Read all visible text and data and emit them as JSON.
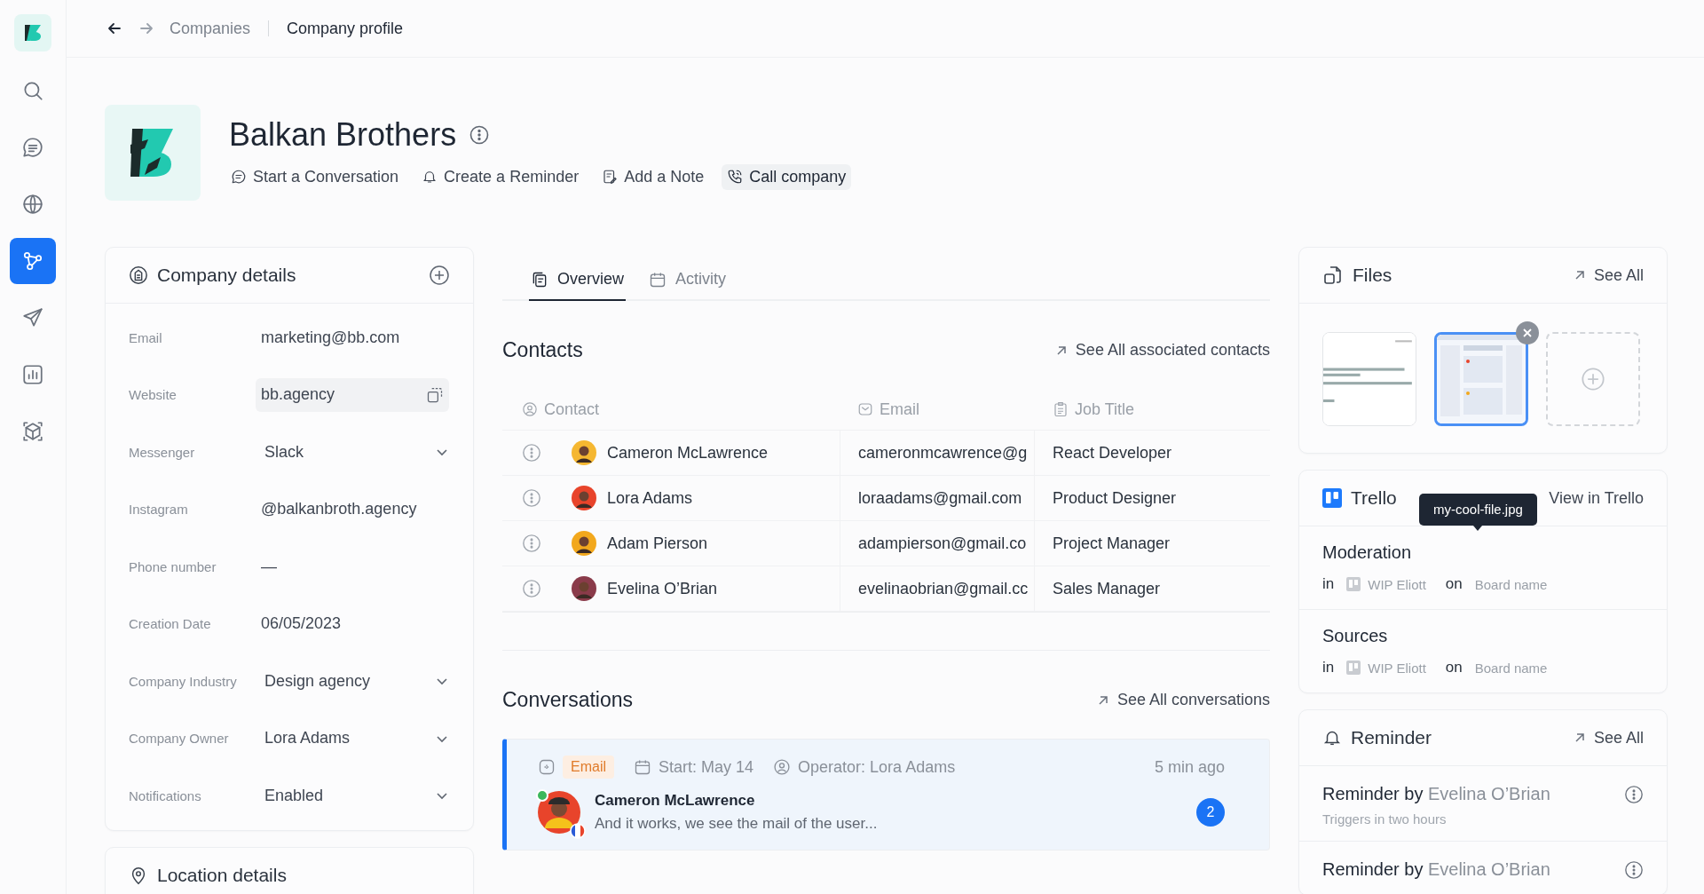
{
  "sidebar": {
    "items": [
      {
        "kind": "search",
        "selected": false
      },
      {
        "kind": "chat",
        "selected": false
      },
      {
        "kind": "globe",
        "selected": false
      },
      {
        "kind": "network",
        "selected": true
      },
      {
        "kind": "send",
        "selected": false
      },
      {
        "kind": "chart",
        "selected": false
      },
      {
        "kind": "cube",
        "selected": false
      }
    ]
  },
  "breadcrumb": [
    "Companies",
    "Company profile"
  ],
  "company": {
    "name": "Balkan Brothers",
    "actions": [
      {
        "kind": "chat",
        "label": "Start a Conversation",
        "highlighted": false
      },
      {
        "kind": "bell",
        "label": "Create a Reminder",
        "highlighted": false
      },
      {
        "kind": "note",
        "label": "Add a Note",
        "highlighted": false
      },
      {
        "kind": "phone",
        "label": "Call company",
        "highlighted": true
      }
    ]
  },
  "details": {
    "title": "Company details",
    "fields": [
      {
        "label": "Email",
        "value": "marketing@bb.com",
        "kind": "text"
      },
      {
        "label": "Website",
        "value": "bb.agency",
        "kind": "copy"
      },
      {
        "label": "Messenger",
        "value": "Slack",
        "kind": "dropdown"
      },
      {
        "label": "Instagram",
        "value": "@balkanbroth.agency",
        "kind": "text"
      },
      {
        "label": "Phone number",
        "value": "—",
        "kind": "text"
      },
      {
        "label": "Creation Date",
        "value": "06/05/2023",
        "kind": "text"
      },
      {
        "label": "Company Industry",
        "value": "Design agency",
        "kind": "dropdown"
      },
      {
        "label": "Company Owner",
        "value": "Lora Adams",
        "kind": "dropdown"
      },
      {
        "label": "Notifications",
        "value": "Enabled",
        "kind": "dropdown"
      }
    ]
  },
  "location": {
    "title": "Location details"
  },
  "tabs": [
    {
      "label": "Overview",
      "kind": "overview",
      "selected": true
    },
    {
      "label": "Activity",
      "kind": "calendar",
      "selected": false
    }
  ],
  "contacts": {
    "title": "Contacts",
    "link": "See All associated contacts",
    "columns": [
      {
        "label": "Contact",
        "kind": "person"
      },
      {
        "label": "Email",
        "kind": "mail"
      },
      {
        "label": "Job Title",
        "kind": "badge"
      }
    ],
    "rows": [
      {
        "name": "Cameron McLawrence",
        "email": "cameronmcawrence@g",
        "job": "React Developer"
      },
      {
        "name": "Lora Adams",
        "email": "loraadams@gmail.com",
        "job": "Product Designer"
      },
      {
        "name": "Adam Pierson",
        "email": "adampierson@gmail.co",
        "job": "Project Manager"
      },
      {
        "name": "Evelina O’Brian",
        "email": "evelinaobrian@gmail.cc",
        "job": "Sales Manager"
      }
    ]
  },
  "conversations": {
    "title": "Conversations",
    "link": "See All conversations",
    "items": [
      {
        "channel": "Email",
        "start": "Start: May 14",
        "operator": "Operator: Lora Adams",
        "time": "5 min ago",
        "name": "Cameron McLawrence",
        "preview": "And it works, we see the mail of the user...",
        "unread": "2",
        "online": true,
        "selected": true
      }
    ]
  },
  "files": {
    "title": "Files",
    "link": "See All",
    "items": [
      {
        "kind": "document",
        "selected": false
      },
      {
        "kind": "screenshot",
        "selected": true
      }
    ],
    "tooltip": "my-cool-file.jpg"
  },
  "trello": {
    "title": "Trello",
    "link": "View in Trello",
    "cards": [
      {
        "title": "Moderation",
        "in": "in",
        "list": "WIP Eliott",
        "on": "on",
        "board": "Board name"
      },
      {
        "title": "Sources",
        "in": "in",
        "list": "WIP Eliott",
        "on": "on",
        "board": "Board name"
      }
    ]
  },
  "reminder": {
    "title": "Reminder",
    "link": "See All",
    "items": [
      {
        "prefix": "Reminder by",
        "person": "Evelina O’Brian",
        "note": "Triggers in two hours"
      },
      {
        "prefix": "Reminder by",
        "person": "Evelina O’Brian"
      }
    ]
  }
}
